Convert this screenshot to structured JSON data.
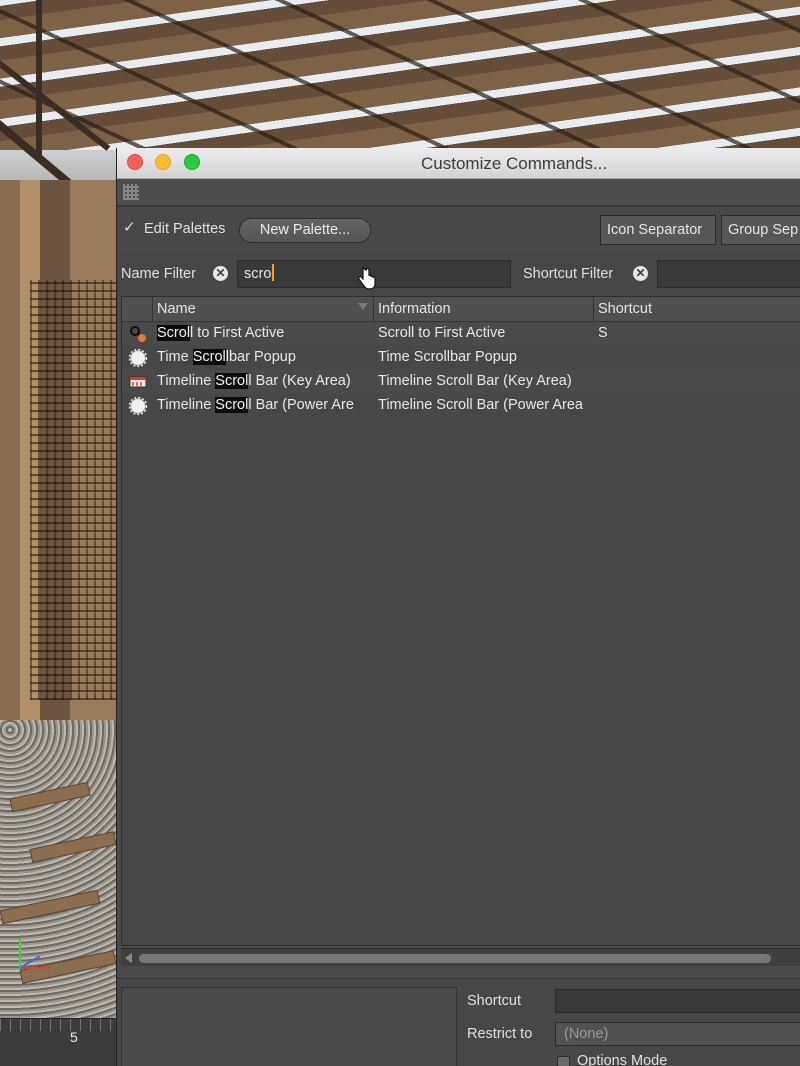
{
  "viewport": {
    "timeline_frame": "5"
  },
  "window": {
    "title": "Customize Commands..."
  },
  "toolbar": {
    "edit_palettes_checked": true,
    "edit_palettes_label": "Edit Palettes",
    "new_palette_label": "New Palette...",
    "icon_separator_label": "Icon Separator",
    "group_separator_label": "Group Sep"
  },
  "filters": {
    "name_filter_label": "Name Filter",
    "name_filter_value": "scro",
    "shortcut_filter_label": "Shortcut Filter",
    "shortcut_filter_value": ""
  },
  "table": {
    "columns": [
      "Name",
      "Information",
      "Shortcut"
    ],
    "rows": [
      {
        "icon": "scroll-to-active-icon",
        "name_pre": "",
        "name_hl": "Scrol",
        "name_post": "l to First Active",
        "info": "Scroll to First Active",
        "shortcut": "S"
      },
      {
        "icon": "gear-icon",
        "name_pre": "Time ",
        "name_hl": "Scrol",
        "name_post": "lbar Popup",
        "info": "Time Scrollbar Popup",
        "shortcut": ""
      },
      {
        "icon": "timeline-icon",
        "name_pre": "Timeline ",
        "name_hl": "Scrol",
        "name_post": "l Bar (Key Area)",
        "info": "Timeline Scroll Bar (Key Area)",
        "shortcut": ""
      },
      {
        "icon": "gear-icon",
        "name_pre": "Timeline ",
        "name_hl": "Scrol",
        "name_post": "l Bar (Power Are",
        "info": "Timeline Scroll Bar (Power Area",
        "shortcut": ""
      }
    ]
  },
  "bottom_panel": {
    "shortcut_label": "Shortcut",
    "shortcut_value": "",
    "restrict_label": "Restrict to",
    "restrict_value": "(None)",
    "options_mode_label": "Options Mode"
  },
  "colors": {
    "caret": "#ff9a1e",
    "highlight": "#0c0c0c",
    "panel_bg": "#4a4a4a"
  }
}
